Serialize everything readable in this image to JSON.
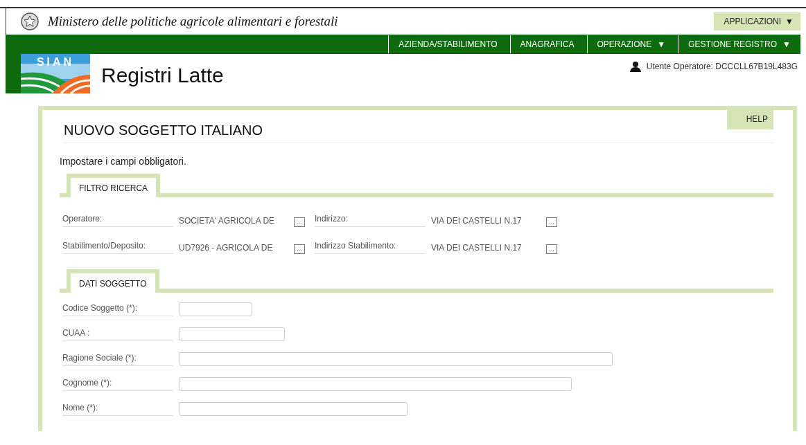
{
  "header": {
    "ministry": "Ministero delle politiche agricole alimentari e forestali",
    "applications_menu": {
      "label": "APPLICAZIONI",
      "caret": "▼"
    }
  },
  "nav": [
    {
      "label": "AZIENDA/STABILIMENTO",
      "kind": "link"
    },
    {
      "label": "ANAGRAFICA",
      "kind": "link"
    },
    {
      "label": "OPERAZIONE",
      "kind": "menu",
      "caret": "▼"
    },
    {
      "label": "GESTIONE REGISTRO",
      "kind": "menu",
      "caret": "▼"
    }
  ],
  "app": {
    "logo_text": "SIAN",
    "title": "Registri Latte",
    "user": "Utente Operatore: DCCCLL67B19L483G"
  },
  "page": {
    "title": "NUOVO SOGGETTO ITALIANO",
    "help": "HELP",
    "note": "Impostare i campi obbligatori.",
    "sections": [
      {
        "tab": "FILTRO RICERCA",
        "kind": "lookup",
        "rows": [
          [
            {
              "label": "Operatore:",
              "value": "SOCIETA' AGRICOLA DE",
              "button": "..."
            },
            {
              "label": "Indirizzo:",
              "value": "VIA DEI CASTELLI N.17",
              "button": "..."
            }
          ],
          [
            {
              "label": "Stabilimento/Deposito:",
              "value": "UD7926 - AGRICOLA DE",
              "button": "..."
            },
            {
              "label": "Indirizzo Stabilimento:",
              "value": "VIA DEI CASTELLI N.17",
              "button": "..."
            }
          ]
        ]
      },
      {
        "tab": "DATI SOGGETTO",
        "kind": "form",
        "fields": [
          {
            "label": "Codice Soggetto (*):"
          },
          {
            "label": "CUAA :"
          },
          {
            "label": "Ragione Sociale (*):"
          },
          {
            "label": "Cognome (*):"
          },
          {
            "label": "Nome (*):"
          }
        ]
      }
    ]
  }
}
